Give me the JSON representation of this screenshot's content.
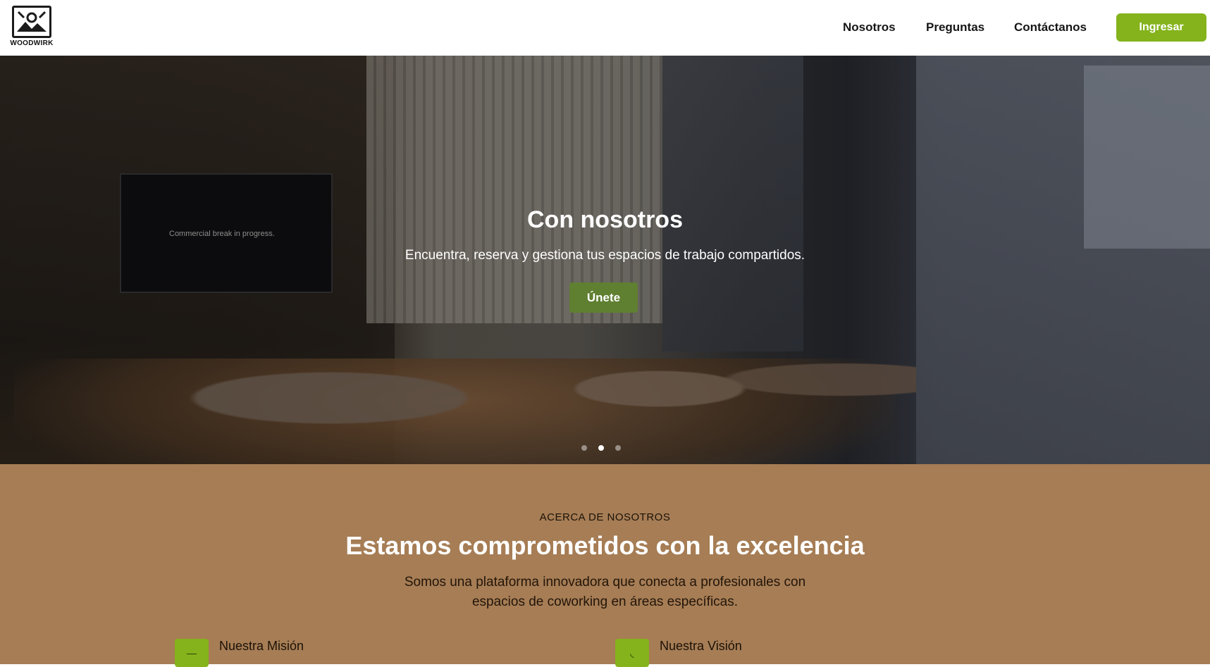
{
  "header": {
    "logo_text": "WOODWIRK",
    "nav": [
      "Nosotros",
      "Preguntas",
      "Contáctanos"
    ],
    "login_label": "Ingresar"
  },
  "hero": {
    "title": "Con nosotros",
    "subtitle": "Encuentra, reserva y gestiona tus espacios de trabajo compartidos.",
    "cta_label": "Únete",
    "tv_text": "Commercial break in progress.",
    "carousel": {
      "slides": 3,
      "active_index": 1
    }
  },
  "about": {
    "eyebrow": "ACERCA DE NOSOTROS",
    "title": "Estamos comprometidos con la excelencia",
    "description": "Somos una plataforma innovadora que conecta a profesionales con espacios de coworking en áreas específicas.",
    "cards": [
      {
        "title": "Nuestra Misión",
        "icon": "mission-icon"
      },
      {
        "title": "Nuestra Visión",
        "icon": "vision-icon"
      }
    ]
  },
  "colors": {
    "accent_green": "#84b31b",
    "cta_green": "#5f7f31",
    "about_bg": "#a67d55"
  }
}
